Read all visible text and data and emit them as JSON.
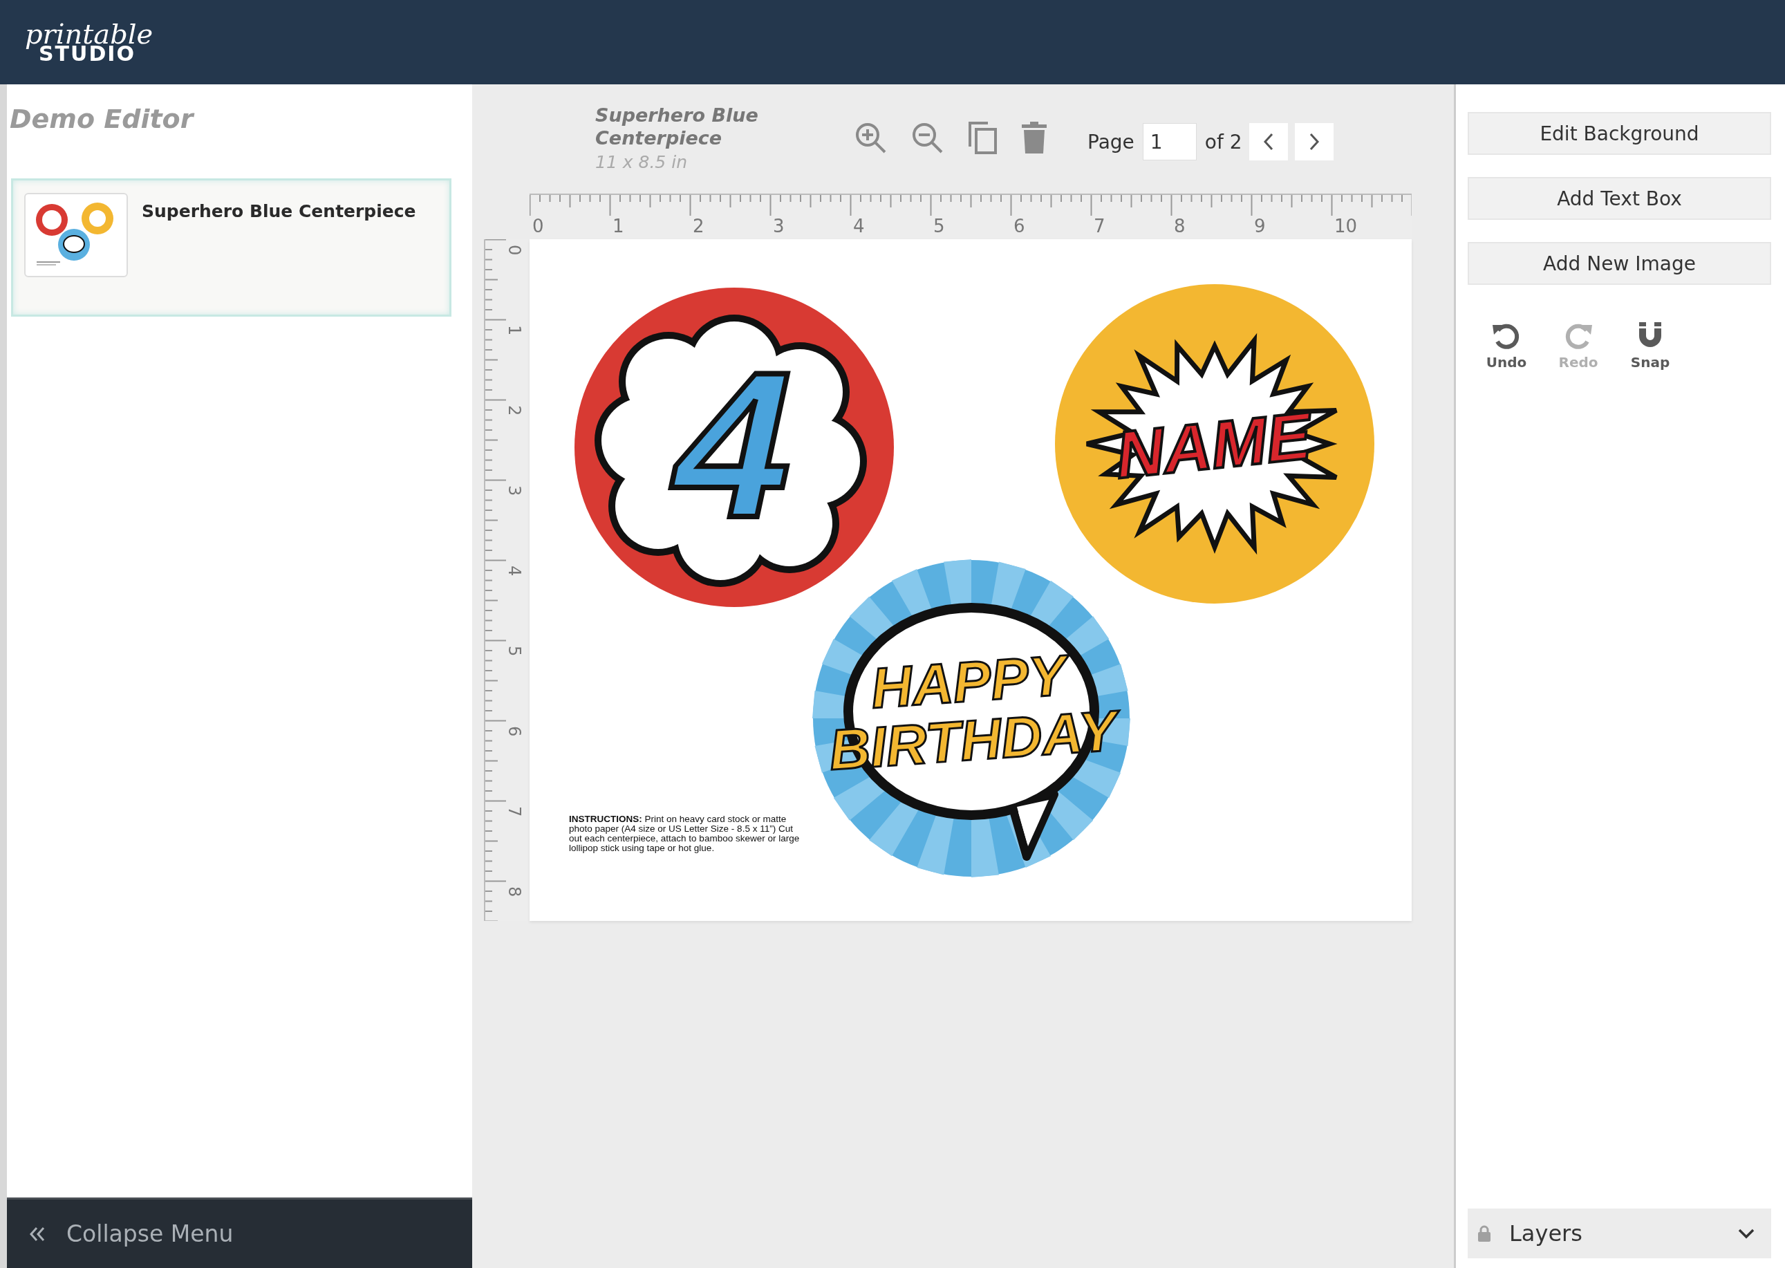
{
  "header": {
    "logo_script": "printable",
    "logo_text": "STUDIO"
  },
  "sidebar": {
    "title": "Demo Editor",
    "projects": [
      {
        "name": "Superhero Blue Centerpiece",
        "selected": true
      }
    ],
    "collapse": "Collapse Menu"
  },
  "toolbar": {
    "title": "Superhero Blue Centerpiece",
    "size": "11 x 8.5 in",
    "page_label": "Page",
    "page_value": "1",
    "page_total": "of 2"
  },
  "ruler": {
    "x_labels": [
      "0",
      "1",
      "2",
      "3",
      "4",
      "5",
      "6",
      "7",
      "8",
      "9",
      "10"
    ],
    "y_labels": [
      "0",
      "1",
      "2",
      "3",
      "4",
      "5",
      "6",
      "7",
      "8"
    ]
  },
  "canvas": {
    "items": [
      {
        "kind": "cloud",
        "lines": [
          "4"
        ]
      },
      {
        "kind": "burst",
        "lines": [
          "NAME"
        ]
      },
      {
        "kind": "speech",
        "lines": [
          "HAPPY",
          "BIRTHDAY"
        ]
      }
    ],
    "instructions": "**INSTRUCTIONS:** Print on heavy card stock or matte photo paper (A4 size or US Letter Size - 8.5 x 11”) Cut out each centerpiece, attach to bamboo skewer or large lollipop stick using tape or hot glue."
  },
  "panel": {
    "buttons": [
      "Edit Background",
      "Add Text Box",
      "Add New Image"
    ],
    "tools": [
      {
        "kind": "undo",
        "label": "Undo",
        "disabled": false
      },
      {
        "kind": "redo",
        "label": "Redo",
        "disabled": true
      },
      {
        "kind": "snap",
        "label": "Snap",
        "disabled": false
      }
    ],
    "layers": "Layers"
  }
}
